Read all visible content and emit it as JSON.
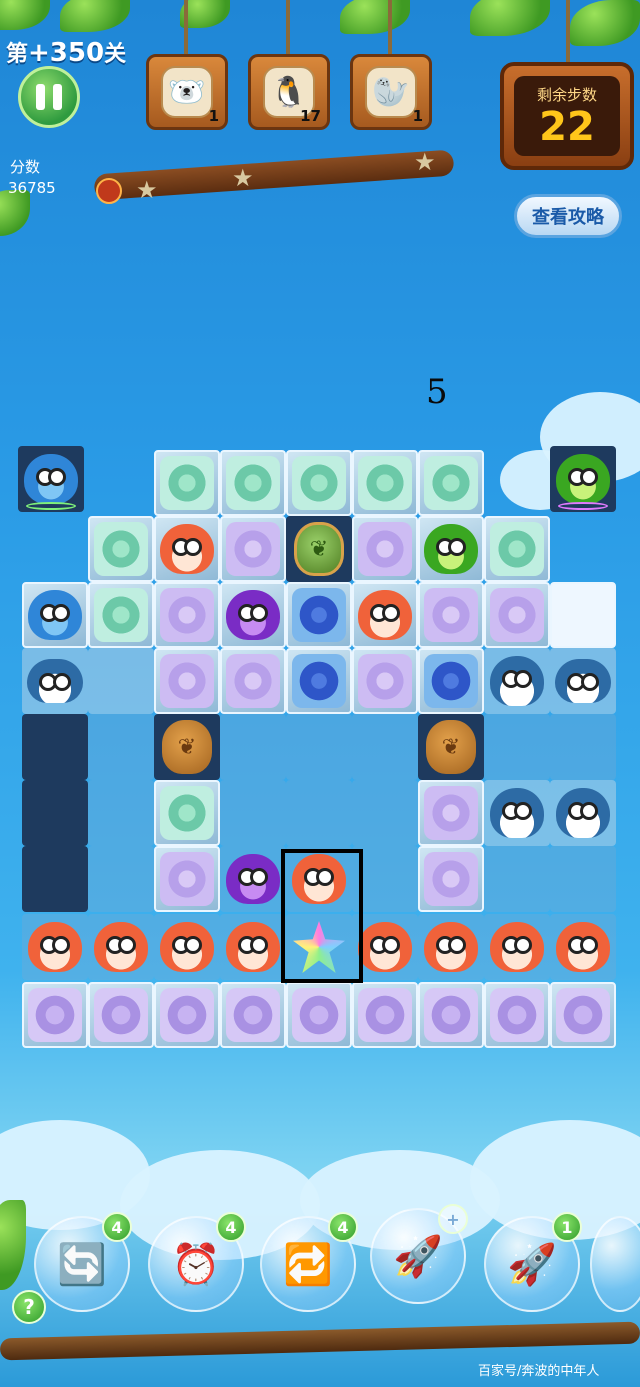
{
  "header": {
    "level_prefix": "第",
    "level_number": "+350",
    "level_suffix": "关",
    "score_label": "分数",
    "score_value": "36785"
  },
  "goals": [
    {
      "icon": "polar-bear-icon",
      "glyph": "🐻‍❄️",
      "count": "1"
    },
    {
      "icon": "penguin-icon",
      "glyph": "🐧",
      "count": "17"
    },
    {
      "icon": "seal-icon",
      "glyph": "🦭",
      "count": "1"
    }
  ],
  "moves": {
    "label": "剩余步数",
    "value": "22"
  },
  "guide_button": {
    "label": "查看攻略"
  },
  "combo_counter": "5",
  "boosters": [
    {
      "icon": "shuffle-booster-icon",
      "glyph": "🔄",
      "count": "4"
    },
    {
      "icon": "clock-booster-icon",
      "glyph": "⏰",
      "count": "4"
    },
    {
      "icon": "swap-booster-icon",
      "glyph": "🔁",
      "count": "4"
    },
    {
      "icon": "horizontal-rocket-booster-icon",
      "glyph": "🚀",
      "count": "+"
    },
    {
      "icon": "vertical-rocket-booster-icon",
      "glyph": "🚀",
      "count": "1"
    }
  ],
  "help_label": "?",
  "watermark": "百家号/奔波的中年人",
  "colors": {
    "sky": "#2a9be6",
    "wood": "#a65a1f",
    "moves_digits": "#ffc61a",
    "badge_green": "#2f9b2a"
  }
}
